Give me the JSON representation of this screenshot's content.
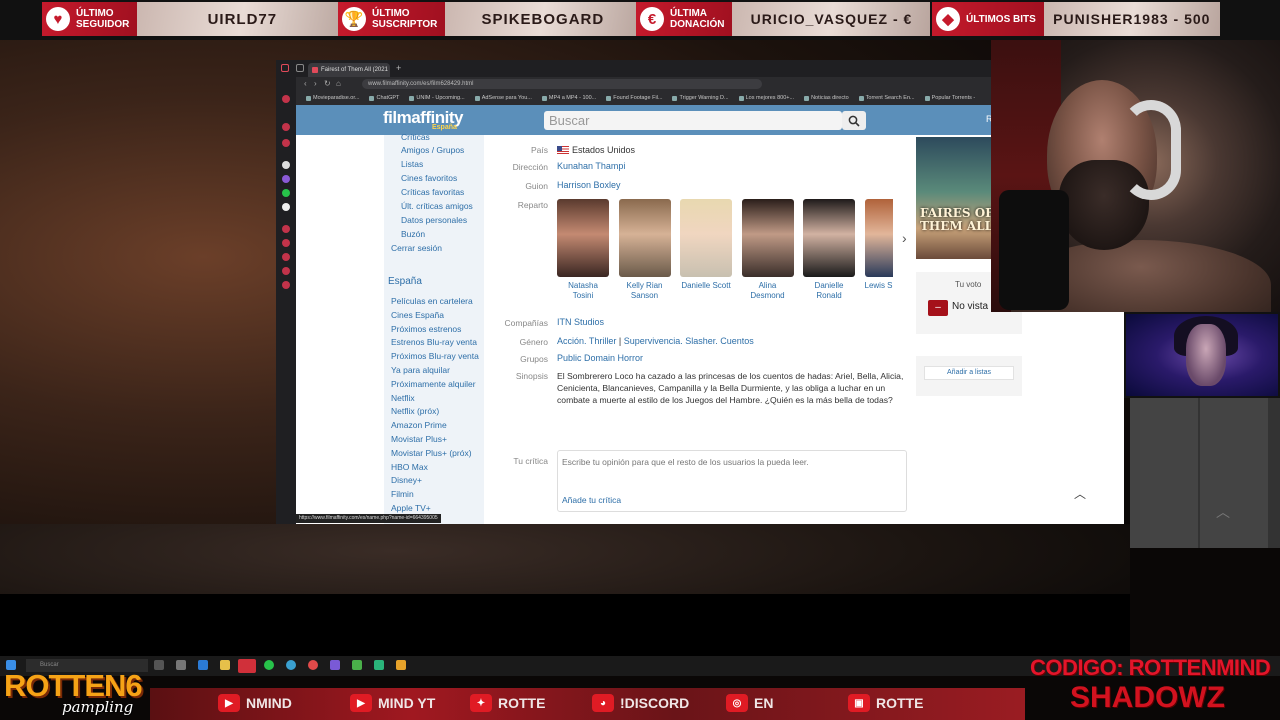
{
  "alerts": [
    {
      "badge": "ÚLTIMO\nSEGUIDOR",
      "value": "UIRLD77",
      "icon": "heart-icon"
    },
    {
      "badge": "ÚLTIMO\nSUSCRIPTOR",
      "value": "SPIKEBOGARD",
      "icon": "trophy-icon"
    },
    {
      "badge": "ÚLTIMA\nDONACIÓN",
      "value": "URICIO_VASQUEZ - €",
      "icon": "donation-icon"
    },
    {
      "badge": "ÚLTIMOS BITS",
      "value": "PUNISHER1983 - 500",
      "icon": "bits-icon"
    }
  ],
  "browser": {
    "tab_title": "Fairest of Them All (2021",
    "url": "www.filmaffinity.com/es/film628429.html",
    "bookmarks": [
      "Movieparadise.or...",
      "ChatGPT",
      "UNIM - Upcoming...",
      "AdSense para You...",
      "MP4 a MP4 - 100...",
      "Found Footage Fil...",
      "Trigger Warning D...",
      "Los mejores 800+...",
      "Noticias directo",
      "Torrent Search En...",
      "Popular Torrents -"
    ],
    "status_url": "https://www.filmaffinity.com/es/name.php?name-id=664395005"
  },
  "site": {
    "logo": "filmaffinity",
    "logo_sub": "España",
    "search_placeholder": "Buscar",
    "user": "Rotten",
    "sidebar_user": [
      "Críticas",
      "Amigos / Grupos",
      "Listas",
      "Cines favoritos",
      "Críticas favoritas",
      "Últ. críticas amigos",
      "Datos personales",
      "Buzón"
    ],
    "logout": "Cerrar sesión",
    "section": "España",
    "sidebar_spain": [
      "Películas en cartelera",
      "Cines España",
      "Próximos estrenos",
      "Estrenos Blu-ray venta",
      "Próximos Blu-ray venta",
      "Ya para alquilar",
      "Próximamente alquiler",
      "Netflix",
      "Netflix (próx)",
      "Amazon Prime",
      "Movistar Plus+",
      "Movistar Plus+ (próx)",
      "HBO Max",
      "Disney+",
      "Filmin",
      "Apple TV+"
    ]
  },
  "film": {
    "labels": {
      "country": "País",
      "director": "Dirección",
      "writer": "Guion",
      "cast": "Reparto",
      "companies": "Compañías",
      "genre": "Género",
      "groups": "Grupos",
      "synopsis": "Sinopsis",
      "your_review": "Tu crítica"
    },
    "country": "Estados Unidos",
    "director": "Kunahan Thampi",
    "writer": "Harrison Boxley",
    "cast": [
      {
        "name": "Natasha Tosini"
      },
      {
        "name": "Kelly Rian Sanson"
      },
      {
        "name": "Danielle Scott"
      },
      {
        "name": "Alina Desmond"
      },
      {
        "name": "Danielle Ronald"
      },
      {
        "name": "Lewis S"
      }
    ],
    "companies": "ITN Studios",
    "genre_a": "Acción. Thriller",
    "genre_sep": "|",
    "genre_b": "Supervivencia. Slasher. Cuentos",
    "groups": "Public Domain Horror",
    "synopsis": "El Sombrerero Loco ha cazado a las princesas de los cuentos de hadas: Ariel, Bella, Alicia, Cenicienta, Blancanieves, Campanilla y la Bella Durmiente, y las obliga a luchar en un combate a muerte al estilo de los Juegos del Hambre. ¿Quién es la más bella de todas?",
    "review_placeholder": "Escribe tu opinión para que el resto de los usuarios la pueda leer.",
    "review_add": "Añade tu crítica",
    "poster_title": "FAIRES OF THEM ALL",
    "vote_label": "Tu voto",
    "vote_button": "–",
    "vote_value": "No vista",
    "add_to_list": "Añadir a listas"
  },
  "taskbar": {
    "search": "Buscar"
  },
  "overlay": {
    "codigo": "CODIGO: ROTTENMIND",
    "shadowz": "SHADOWZ",
    "logo": "ROTTEN6",
    "logo_sub": "pampling"
  },
  "ticker": [
    {
      "text": "NMIND",
      "icon": "youtube-icon"
    },
    {
      "text": "MIND YT",
      "icon": "youtube-icon"
    },
    {
      "text": "ROTTE",
      "icon": "twitter-icon"
    },
    {
      "text": "!DISCORD",
      "icon": "discord-icon"
    },
    {
      "text": "EN",
      "icon": "instagram-icon"
    },
    {
      "text": "ROTTE",
      "icon": "twitch-icon"
    }
  ],
  "colors": {
    "accent": "#c51a2c",
    "site_header": "#5b8fba",
    "link": "#2e6fa8",
    "vote_red": "#a5111a",
    "logo_orange": "#f6a316"
  }
}
